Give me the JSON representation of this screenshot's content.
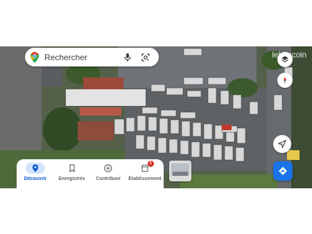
{
  "search": {
    "placeholder": "Rechercher"
  },
  "watermark": "leboncoin",
  "nav": {
    "items": [
      {
        "label": "Découvrir",
        "icon": "location-pin-icon",
        "active": true
      },
      {
        "label": "Enregistrés",
        "icon": "bookmark-icon",
        "active": false
      },
      {
        "label": "Contribuer",
        "icon": "add-circle-icon",
        "active": false
      },
      {
        "label": "Établissement",
        "icon": "business-icon",
        "active": false,
        "badge": "1"
      }
    ]
  },
  "map_controls": [
    "layers-icon",
    "compass-icon",
    "my-location-icon",
    "directions-icon"
  ],
  "colors": {
    "accent": "#1a73e8",
    "active_nav": "#0b57d0",
    "badge": "#d93025"
  }
}
